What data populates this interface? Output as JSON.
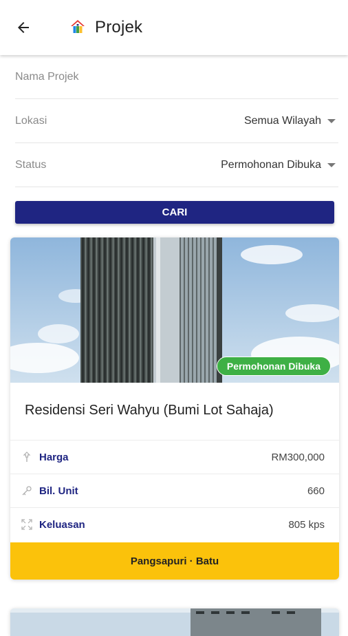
{
  "appbar": {
    "title": "Projek",
    "back_icon": "arrow-left-icon",
    "logo_icon": "house-logo-icon"
  },
  "filters": {
    "name_placeholder": "Nama Projek",
    "location": {
      "label": "Lokasi",
      "value": "Semua Wilayah"
    },
    "status": {
      "label": "Status",
      "value": "Permohonan Dibuka"
    }
  },
  "search_button": "CARI",
  "projects": [
    {
      "status_badge": "Permohonan Dibuka",
      "title": "Residensi Seri Wahyu (Bumi Lot Sahaja)",
      "details": [
        {
          "label": "Harga",
          "value": "RM300,000",
          "icon": "price-tag-icon"
        },
        {
          "label": "Bil. Unit",
          "value": "660",
          "icon": "key-icon"
        },
        {
          "label": "Keluasan",
          "value": "805 kps",
          "icon": "expand-arrows-icon"
        }
      ],
      "footer": "Pangsapuri · Batu"
    }
  ],
  "colors": {
    "primary": "#1f2582",
    "status_green": "#3eb045",
    "footer_yellow": "#fbc20b"
  }
}
